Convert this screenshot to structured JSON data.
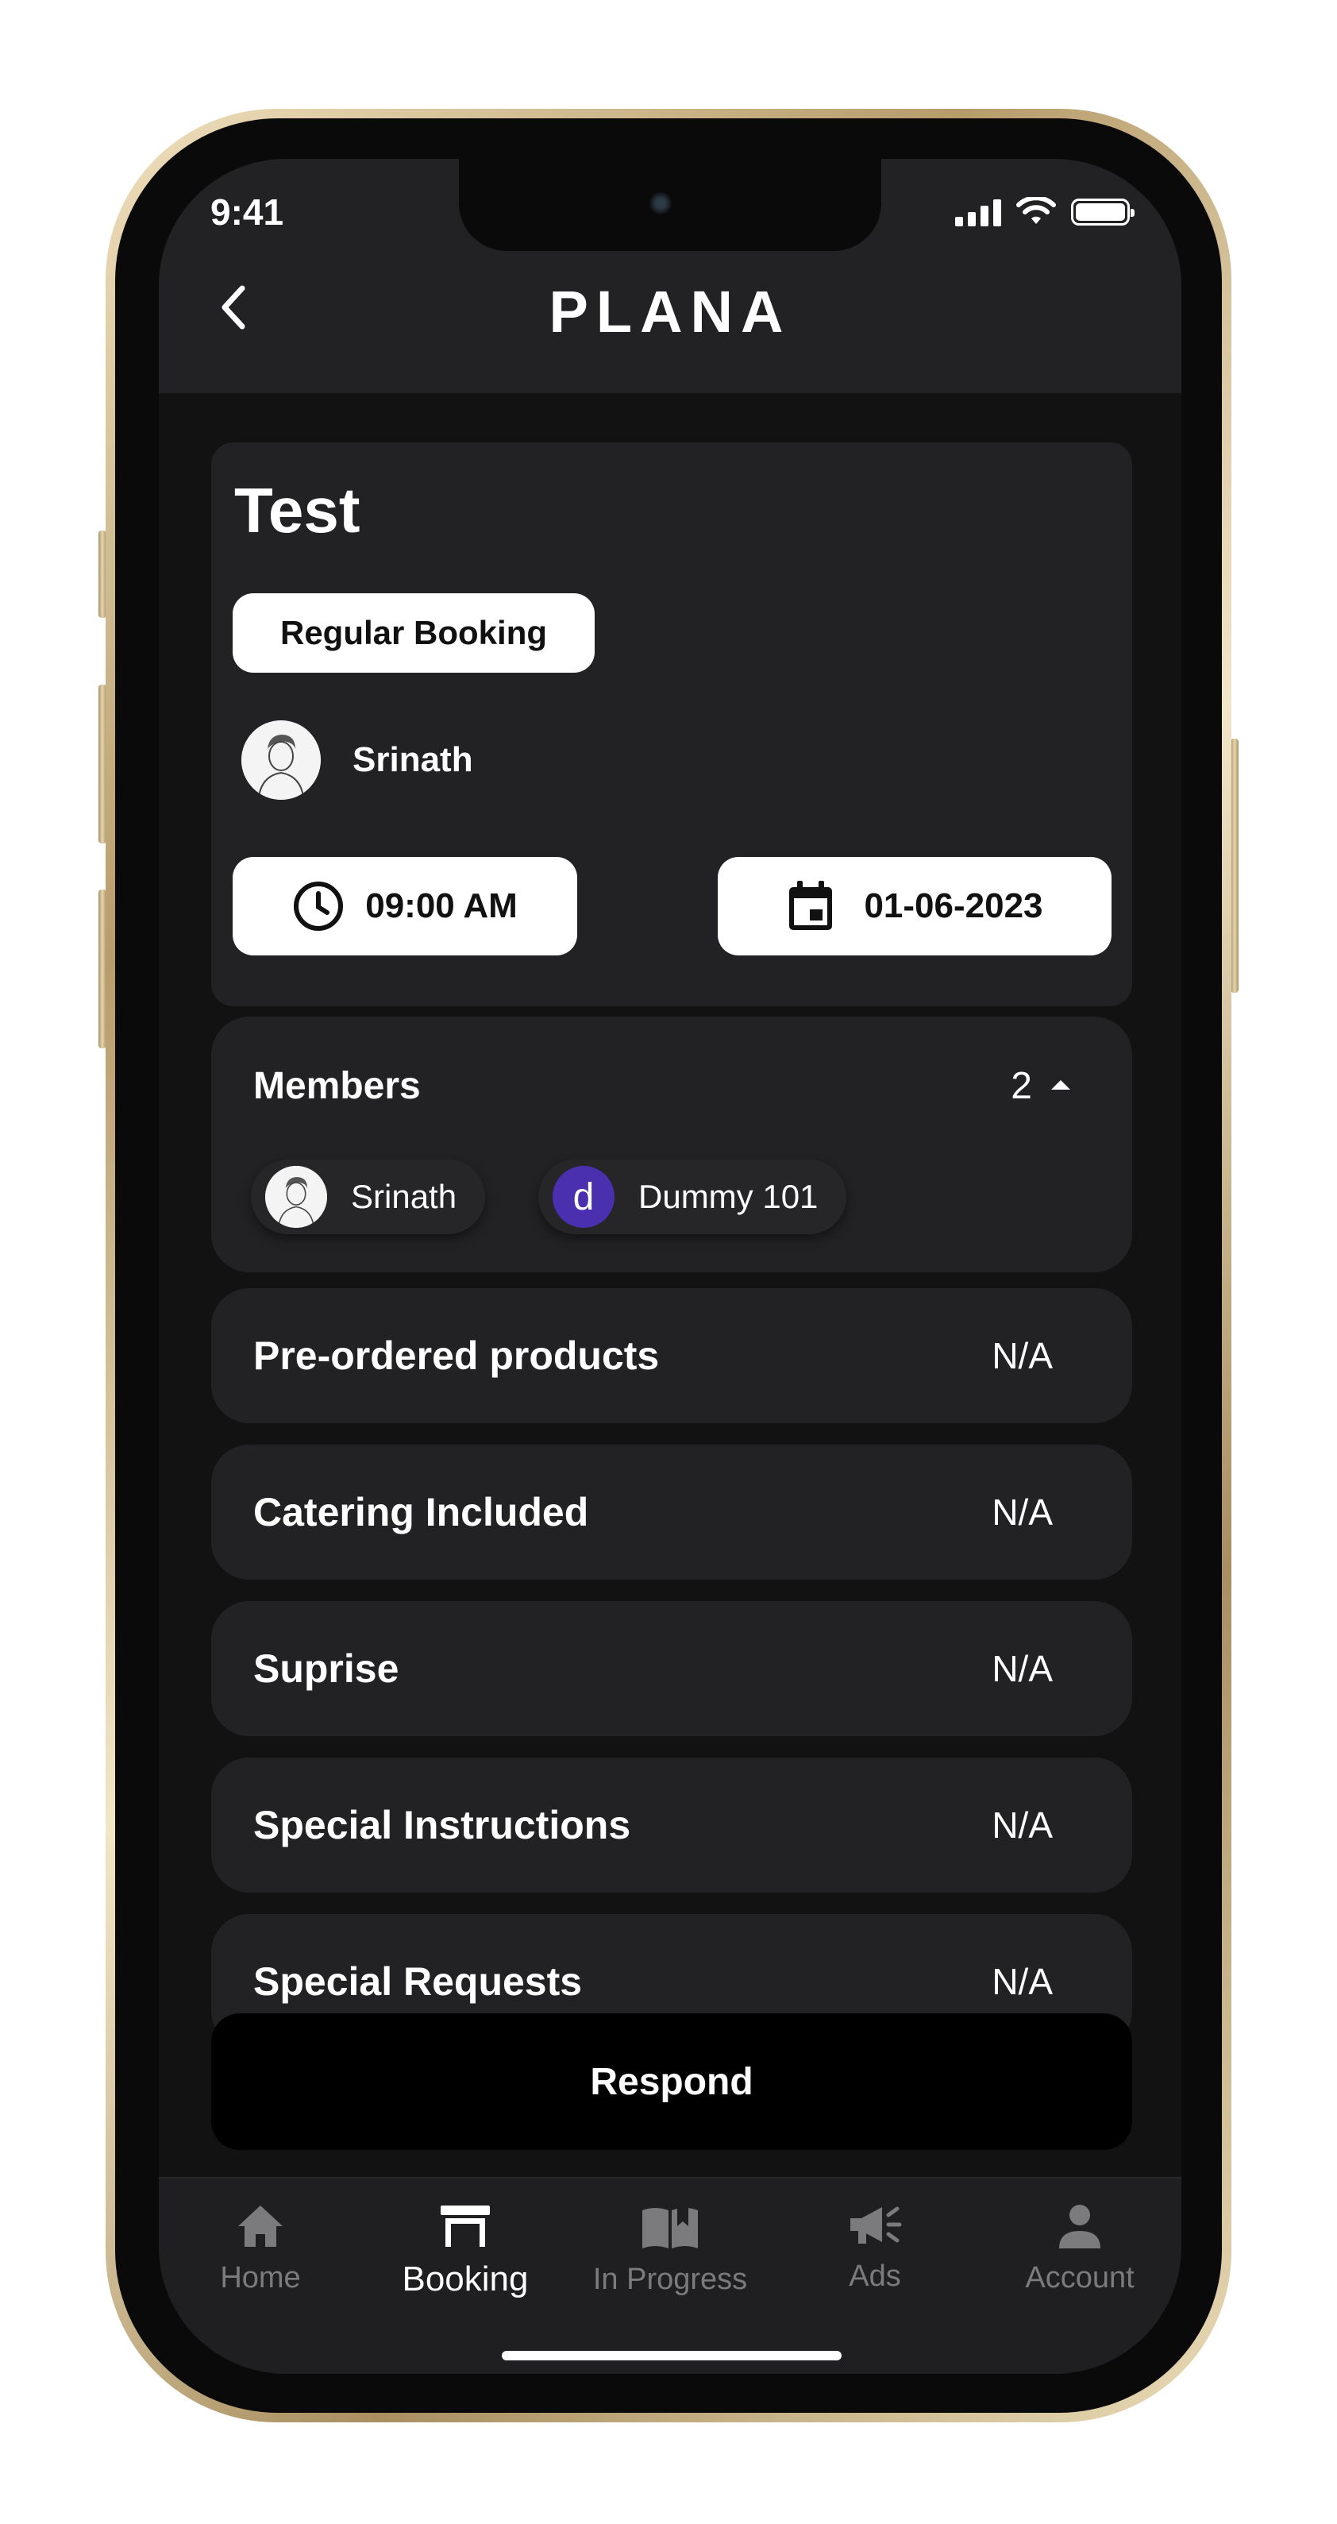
{
  "status_bar": {
    "time": "9:41"
  },
  "header": {
    "logo": "PLANA"
  },
  "booking": {
    "title": "Test",
    "type": "Regular Booking",
    "host_name": "Srinath",
    "time": "09:00 AM",
    "date": "01-06-2023"
  },
  "members": {
    "title": "Members",
    "count": "2",
    "list": [
      {
        "name": "Srinath",
        "avatar": "photo"
      },
      {
        "name": "Dummy 101",
        "initial": "d",
        "color": "#4a2fae"
      }
    ]
  },
  "details": [
    {
      "label": "Pre-ordered products",
      "value": "N/A"
    },
    {
      "label": "Catering Included",
      "value": "N/A"
    },
    {
      "label": "Suprise",
      "value": "N/A"
    },
    {
      "label": "Special Instructions",
      "value": "N/A"
    },
    {
      "label": "Special Requests",
      "value": "N/A"
    }
  ],
  "respond_label": "Respond",
  "tabs": [
    {
      "label": "Home",
      "icon": "home-icon"
    },
    {
      "label": "Booking",
      "icon": "table-icon",
      "active": true
    },
    {
      "label": "In Progress",
      "icon": "book-icon"
    },
    {
      "label": "Ads",
      "icon": "megaphone-icon"
    },
    {
      "label": "Account",
      "icon": "person-icon"
    }
  ],
  "colors": {
    "background": "#121213",
    "card": "#222224",
    "accent_avatar": "#4a2fae"
  }
}
